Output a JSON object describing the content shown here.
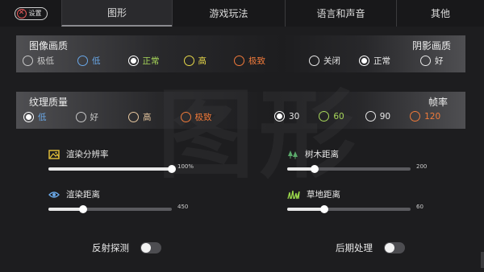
{
  "tabs": {
    "back_label": "设置",
    "items": [
      {
        "label": "图形",
        "active": true
      },
      {
        "label": "游戏玩法",
        "active": false
      },
      {
        "label": "语言和声音",
        "active": false
      },
      {
        "label": "其他",
        "active": false
      }
    ]
  },
  "watermark": "图形",
  "image_quality": {
    "title": "图像画质",
    "selected": "正常",
    "options": [
      {
        "label": "极低",
        "color": "#c8c8c8"
      },
      {
        "label": "低",
        "color": "#6aa8e8"
      },
      {
        "label": "正常",
        "color": "#a8d85a"
      },
      {
        "label": "高",
        "color": "#e8d84a"
      },
      {
        "label": "极致",
        "color": "#f07a3a"
      }
    ]
  },
  "shadow_quality": {
    "title": "阴影画质",
    "selected": "正常",
    "options": [
      {
        "label": "关闭",
        "color": "#e8e8e8"
      },
      {
        "label": "正常",
        "color": "#e8e8e8"
      },
      {
        "label": "好",
        "color": "#e8e8e8"
      }
    ]
  },
  "texture_quality": {
    "title": "纹理质量",
    "selected": "低",
    "options": [
      {
        "label": "低",
        "color": "#6aa8e8"
      },
      {
        "label": "好",
        "color": "#c8c8c8"
      },
      {
        "label": "高",
        "color": "#e8c8a0"
      },
      {
        "label": "极致",
        "color": "#f07a3a"
      }
    ]
  },
  "frame_rate": {
    "title": "帧率",
    "selected": "30",
    "options": [
      {
        "label": "30",
        "color": "#e8e8e8"
      },
      {
        "label": "60",
        "color": "#a8d85a"
      },
      {
        "label": "90",
        "color": "#e8e8e8"
      },
      {
        "label": "120",
        "color": "#f07a3a"
      }
    ]
  },
  "sliders": {
    "render_resolution": {
      "label": "渲染分辨率",
      "value_text": "100%",
      "fraction": 1.0,
      "icon": "image-icon"
    },
    "render_distance": {
      "label": "渲染距离",
      "value_text": "450",
      "fraction": 0.28,
      "icon": "eye-icon"
    },
    "tree_distance": {
      "label": "树木距离",
      "value_text": "200",
      "fraction": 0.22,
      "icon": "tree-icon"
    },
    "grass_distance": {
      "label": "草地距离",
      "value_text": "60",
      "fraction": 0.3,
      "icon": "grass-icon"
    }
  },
  "toggles": {
    "reflection": {
      "label": "反射探测",
      "on": false
    },
    "post_processing": {
      "label": "后期处理",
      "on": false
    }
  }
}
